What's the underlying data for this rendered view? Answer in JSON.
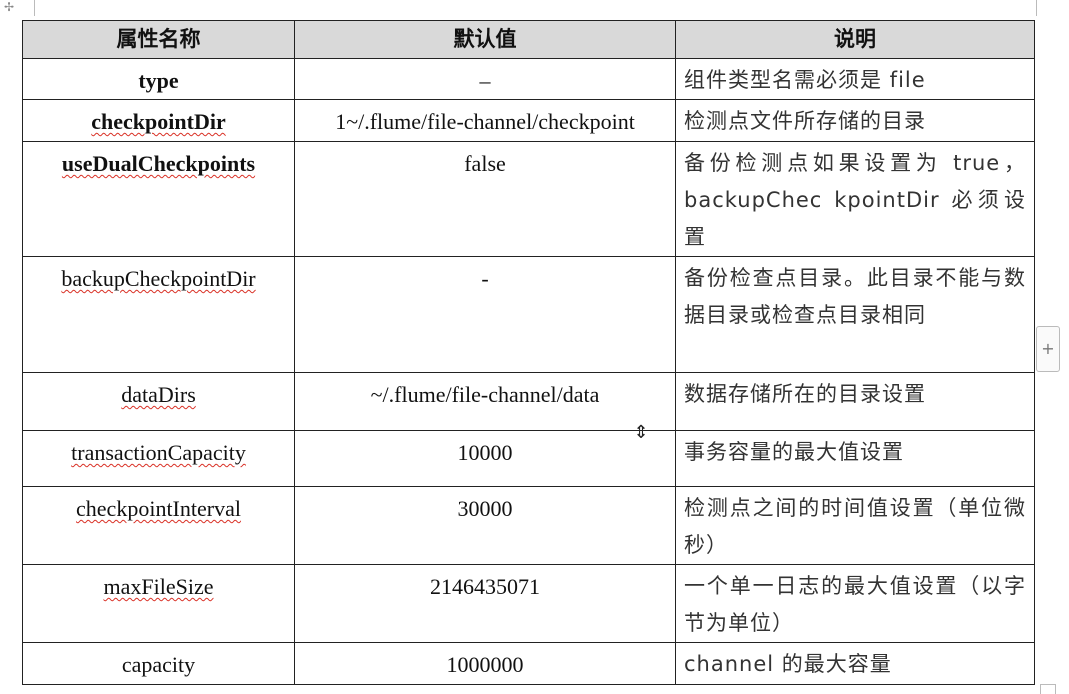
{
  "table": {
    "headers": [
      "属性名称",
      "默认值",
      "说明"
    ],
    "rows": [
      {
        "name": "type",
        "default": "–",
        "desc": "组件类型名需必须是 file"
      },
      {
        "name": "checkpointDir",
        "default": "1~/.flume/file-channel/checkpoint",
        "desc": "检测点文件所存储的目录"
      },
      {
        "name": "useDualCheckpoints",
        "default": "false",
        "desc": "备份检测点如果设置为 true，backupChec kpointDir 必须设置"
      },
      {
        "name": "backupCheckpointDir",
        "default": "-",
        "desc": "备份检查点目录。此目录不能与数据目录或检查点目录相同"
      },
      {
        "name": "dataDirs",
        "default": "~/.flume/file-channel/data",
        "desc": "数据存储所在的目录设置"
      },
      {
        "name": "transactionCapacity",
        "default": "10000",
        "desc": "事务容量的最大值设置"
      },
      {
        "name": "checkpointInterval",
        "default": "30000",
        "desc": "检测点之间的时间值设置（单位微秒）"
      },
      {
        "name": "maxFileSize",
        "default": "2146435071",
        "desc": "一个单一日志的最大值设置（以字节为单位）"
      },
      {
        "name": "capacity",
        "default": "1000000",
        "desc": "channel 的最大容量"
      }
    ]
  },
  "icons": {
    "corner": "move-handle-icon",
    "add": "add-column-icon",
    "cursor": "row-resize-cursor-icon"
  },
  "colors": {
    "header_bg": "#d9d9d9",
    "spellcheck": "#d93025"
  }
}
